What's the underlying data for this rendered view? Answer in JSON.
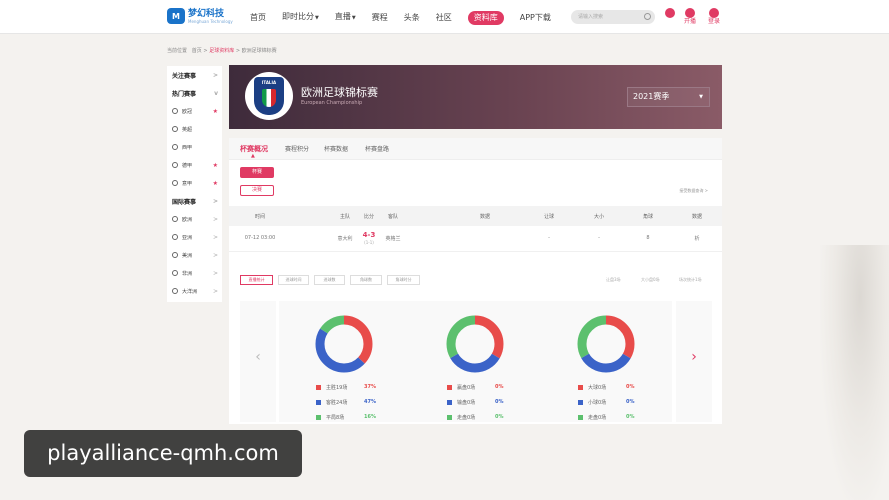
{
  "nav": {
    "logo_text": "梦幻科技",
    "logo_sub": "Menghuan Technology",
    "items": [
      {
        "label": "首页",
        "dropdown": false,
        "active": false
      },
      {
        "label": "即时比分",
        "dropdown": true,
        "active": false
      },
      {
        "label": "直播",
        "dropdown": true,
        "active": false
      },
      {
        "label": "赛程",
        "dropdown": false,
        "active": false
      },
      {
        "label": "头条",
        "dropdown": false,
        "active": false
      },
      {
        "label": "社区",
        "dropdown": false,
        "active": false
      },
      {
        "label": "资料库",
        "dropdown": false,
        "active": true
      },
      {
        "label": "APP下载",
        "dropdown": false,
        "active": false
      }
    ],
    "search_placeholder": "请输入搜索",
    "publish_label": "开播",
    "login_label": "登录",
    "accent": "#e03a63"
  },
  "breadcrumb": {
    "prefix": "当前位置",
    "home": "首页",
    "sep": ">",
    "section": "足球资料库",
    "current": "欧洲足球锦标赛"
  },
  "sidebar": {
    "items": [
      {
        "label": "关注赛事",
        "type": "head",
        "chevron": ">"
      },
      {
        "label": "热门赛事",
        "type": "head",
        "chevron": "v"
      },
      {
        "label": "欧冠",
        "type": "item",
        "star": true
      },
      {
        "label": "英超",
        "type": "item",
        "star": false
      },
      {
        "label": "西甲",
        "type": "item",
        "star": false
      },
      {
        "label": "德甲",
        "type": "item",
        "star": true
      },
      {
        "label": "意甲",
        "type": "item",
        "star": true
      },
      {
        "label": "国际赛事",
        "type": "head",
        "chevron": ">"
      },
      {
        "label": "欧洲",
        "type": "item",
        "chevron": ">"
      },
      {
        "label": "亚洲",
        "type": "item",
        "chevron": ">"
      },
      {
        "label": "美洲",
        "type": "item",
        "chevron": ">"
      },
      {
        "label": "非洲",
        "type": "item",
        "chevron": ">"
      },
      {
        "label": "大洋洲",
        "type": "item",
        "chevron": ">"
      }
    ]
  },
  "banner": {
    "emblem_text": "ITALIA",
    "title": "欧洲足球锦标赛",
    "subtitle": "European Championship",
    "season": "2021赛季"
  },
  "tabs": [
    "杯赛概况",
    "赛程积分",
    "杯赛数据",
    "杯赛盘路"
  ],
  "stage_buttons": [
    "杯赛",
    "决赛"
  ],
  "group_link": "接受数据查询 >",
  "table": {
    "headers": [
      "时间",
      "主队",
      "比分",
      "客队",
      "数据",
      "让球",
      "大小",
      "角球",
      "数据"
    ],
    "rows": [
      {
        "time": "07-12 03:00",
        "home": "意大利",
        "score": "4-3",
        "half": "(1-1)",
        "away": "英格兰",
        "data": "",
        "handicap": "-",
        "overunder": "-",
        "corner": "8",
        "extra": "析"
      }
    ]
  },
  "stat_filters": [
    "直播统计",
    "进球时间",
    "进球数",
    "角球数",
    "角球时分"
  ],
  "stat_links": [
    "让盘3场",
    "大小盘0场",
    "场次统计1场"
  ],
  "chart_data": [
    {
      "type": "pie",
      "series": [
        {
          "name": "主胜19场",
          "value": 37,
          "label": "37%",
          "color": "#e84c4a"
        },
        {
          "name": "客胜24场",
          "value": 47,
          "label": "47%",
          "color": "#3b63c8"
        },
        {
          "name": "平局8场",
          "value": 16,
          "label": "16%",
          "color": "#5cc06e"
        }
      ]
    },
    {
      "type": "pie",
      "series": [
        {
          "name": "赢盘0场",
          "value": 33.3,
          "label": "0%",
          "color": "#e84c4a"
        },
        {
          "name": "输盘0场",
          "value": 33.3,
          "label": "0%",
          "color": "#3b63c8"
        },
        {
          "name": "走盘0场",
          "value": 33.3,
          "label": "0%",
          "color": "#5cc06e"
        }
      ]
    },
    {
      "type": "pie",
      "series": [
        {
          "name": "大球0场",
          "value": 33.3,
          "label": "0%",
          "color": "#e84c4a"
        },
        {
          "name": "小球0场",
          "value": 33.3,
          "label": "0%",
          "color": "#3b63c8"
        },
        {
          "name": "走盘0场",
          "value": 33.3,
          "label": "0%",
          "color": "#5cc06e"
        }
      ]
    }
  ],
  "carousel": {
    "prev": "‹",
    "next": "›"
  },
  "watermark": "playalliance-qmh.com"
}
